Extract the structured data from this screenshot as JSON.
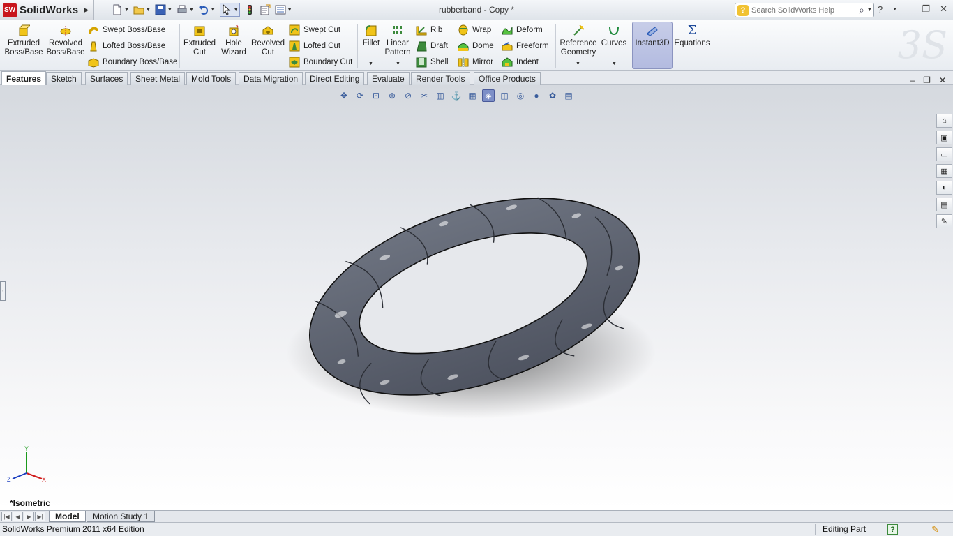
{
  "app": {
    "logo_mark": "SW",
    "logo_text": "SolidWorks"
  },
  "document": {
    "title": "rubberband - Copy *"
  },
  "search": {
    "placeholder": "Search SolidWorks Help",
    "q_glyph": "?"
  },
  "window_controls": {
    "help": "?",
    "minimize": "–",
    "restore": "❐",
    "close": "✕"
  },
  "ribbon": {
    "extruded_boss": "Extruded Boss/Base",
    "revolved_boss": "Revolved Boss/Base",
    "swept_boss": "Swept Boss/Base",
    "lofted_boss": "Lofted Boss/Base",
    "boundary_boss": "Boundary Boss/Base",
    "extruded_cut": "Extruded Cut",
    "hole_wizard": "Hole Wizard",
    "revolved_cut": "Revolved Cut",
    "swept_cut": "Swept Cut",
    "lofted_cut": "Lofted Cut",
    "boundary_cut": "Boundary Cut",
    "fillet": "Fillet",
    "linear_pattern": "Linear Pattern",
    "rib": "Rib",
    "draft": "Draft",
    "shell": "Shell",
    "wrap": "Wrap",
    "dome": "Dome",
    "mirror": "Mirror",
    "deform": "Deform",
    "freeform": "Freeform",
    "indent": "Indent",
    "reference_geometry": "Reference Geometry",
    "curves": "Curves",
    "instant3d": "Instant3D",
    "equations": "Equations",
    "equations_glyph": "Σ"
  },
  "tabs": [
    "Features",
    "Sketch",
    "Surfaces",
    "Sheet Metal",
    "Mold Tools",
    "Data Migration",
    "Direct Editing",
    "Evaluate",
    "Render Tools",
    "Office Products"
  ],
  "viewport": {
    "view_name": "*Isometric",
    "triad": {
      "y": "Y",
      "x": "X",
      "z": "Z"
    }
  },
  "bottom_tabs": [
    "Model",
    "Motion Study 1"
  ],
  "status": {
    "left": "SolidWorks Premium 2011 x64 Edition",
    "right": "Editing Part",
    "help": "?"
  },
  "colors": {
    "part": "#5c6270",
    "accent": "#c8161d",
    "instant3d_bg": "#b3bbe0"
  }
}
